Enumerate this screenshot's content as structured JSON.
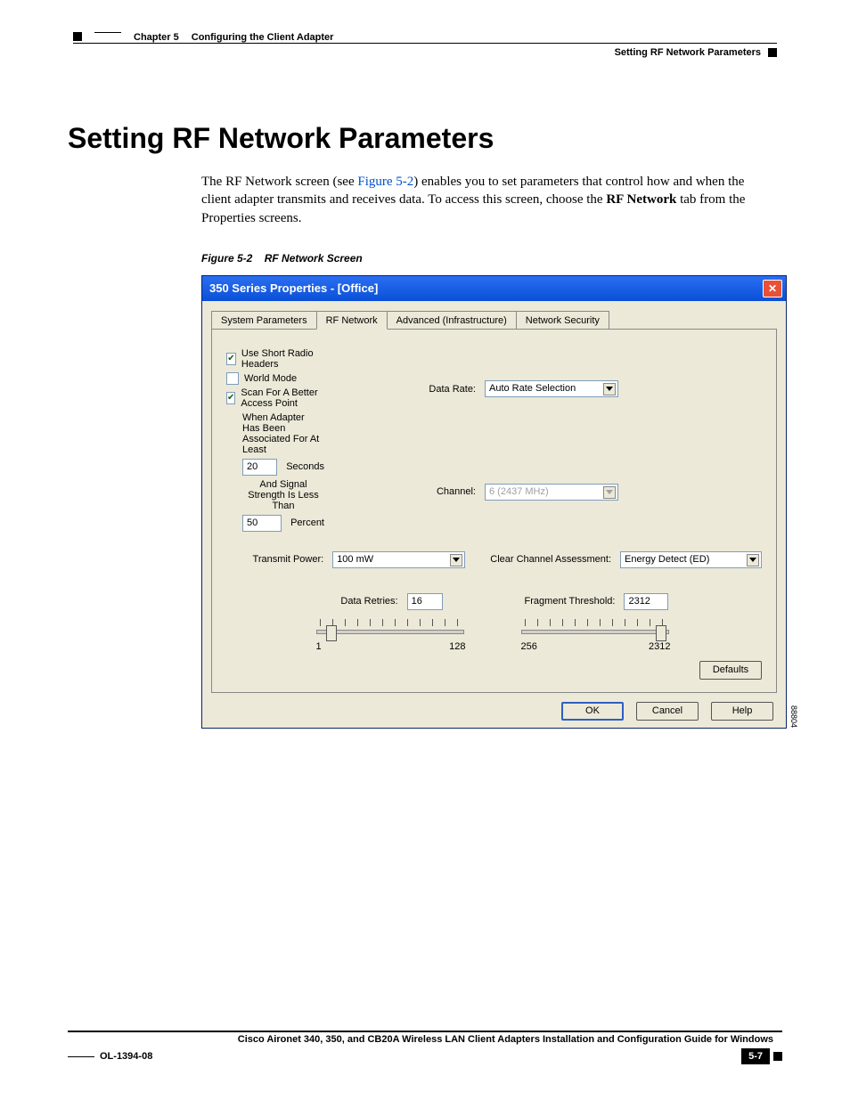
{
  "header": {
    "chapter_label": "Chapter 5",
    "chapter_title": "Configuring the Client Adapter",
    "section_title": "Setting RF Network Parameters"
  },
  "section_heading": "Setting RF Network Parameters",
  "paragraph": {
    "pre": "The RF Network screen (see ",
    "link": "Figure 5-2",
    "mid": ") enables you to set parameters that control how and when the client adapter transmits and receives data. To access this screen, choose the ",
    "bold": "RF Network",
    "post": " tab from the Properties screens."
  },
  "figure": {
    "number": "Figure 5-2",
    "title": "RF Network Screen",
    "image_id": "88804"
  },
  "dialog": {
    "title": "350 Series Properties - [Office]",
    "tabs": [
      "System Parameters",
      "RF Network",
      "Advanced (Infrastructure)",
      "Network Security"
    ],
    "active_tab": "RF Network",
    "labels": {
      "data_rate": "Data Rate:",
      "channel": "Channel:",
      "transmit_power": "Transmit Power:",
      "cca": "Clear Channel Assessment:",
      "data_retries": "Data Retries:",
      "fragment_threshold": "Fragment Threshold:"
    },
    "values": {
      "data_rate": "Auto Rate Selection",
      "channel": "6   (2437 MHz)",
      "transmit_power": "100 mW",
      "cca": "Energy Detect (ED)",
      "data_retries": "16",
      "fragment_threshold": "2312"
    },
    "checks": {
      "short_headers": {
        "label": "Use Short Radio Headers",
        "checked": true
      },
      "world_mode": {
        "label": "World Mode",
        "checked": false
      },
      "scan_better": {
        "label": "Scan For A Better Access Point",
        "checked": true
      }
    },
    "scan_block": {
      "line1": "When Adapter Has Been Associated For At Least",
      "seconds_value": "20",
      "seconds_label": "Seconds",
      "line2": "And Signal Strength Is Less Than",
      "percent_value": "50",
      "percent_label": "Percent"
    },
    "sliders": {
      "retries": {
        "min": "1",
        "max": "128"
      },
      "fragment": {
        "min": "256",
        "max": "2312"
      }
    },
    "buttons": {
      "defaults": "Defaults",
      "ok": "OK",
      "cancel": "Cancel",
      "help": "Help"
    }
  },
  "footer": {
    "guide_title": "Cisco Aironet 340, 350, and CB20A Wireless LAN Client Adapters Installation and Configuration Guide for Windows",
    "doc_id": "OL-1394-08",
    "page_number": "5-7"
  },
  "chart_data": {
    "type": "ui-form",
    "fields": [
      {
        "name": "Data Rate",
        "value": "Auto Rate Selection",
        "control": "combo"
      },
      {
        "name": "Channel",
        "value": "6 (2437 MHz)",
        "control": "combo",
        "enabled": false
      },
      {
        "name": "Transmit Power",
        "value": "100 mW",
        "control": "combo"
      },
      {
        "name": "Clear Channel Assessment",
        "value": "Energy Detect (ED)",
        "control": "combo"
      },
      {
        "name": "Use Short Radio Headers",
        "value": true,
        "control": "checkbox"
      },
      {
        "name": "World Mode",
        "value": false,
        "control": "checkbox"
      },
      {
        "name": "Scan For A Better Access Point",
        "value": true,
        "control": "checkbox"
      },
      {
        "name": "Associated For At Least (Seconds)",
        "value": 20,
        "control": "textbox"
      },
      {
        "name": "Signal Strength Less Than (Percent)",
        "value": 50,
        "control": "textbox"
      },
      {
        "name": "Data Retries",
        "value": 16,
        "control": "slider",
        "min": 1,
        "max": 128
      },
      {
        "name": "Fragment Threshold",
        "value": 2312,
        "control": "slider",
        "min": 256,
        "max": 2312
      }
    ]
  }
}
